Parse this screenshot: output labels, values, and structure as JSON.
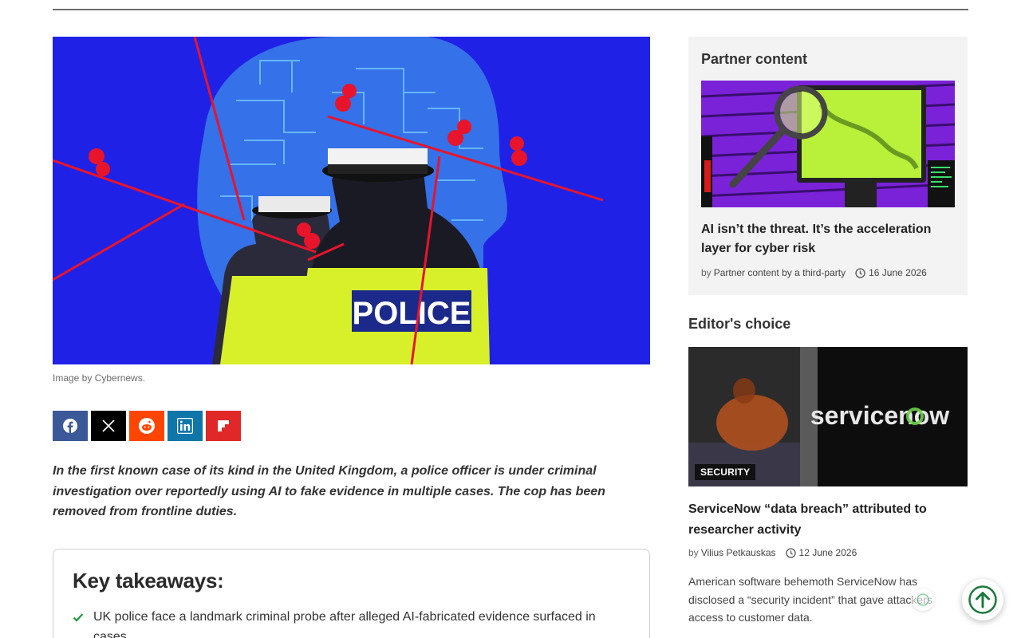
{
  "article": {
    "hero_alt": "Police officers in front of a circuit-board head with red pins and string",
    "caption": "Image by Cybernews.",
    "share": [
      {
        "name": "facebook",
        "color": "#3b5998"
      },
      {
        "name": "x",
        "color": "#000000"
      },
      {
        "name": "reddit",
        "color": "#ff4500"
      },
      {
        "name": "linkedin",
        "color": "#0e76a8"
      },
      {
        "name": "flipboard",
        "color": "#e12828"
      }
    ],
    "lead": "In the first known case of its kind in the United Kingdom, a police officer is under criminal investigation over reportedly using AI to fake evidence in multiple cases. The cop has been removed from frontline duties.",
    "takeaways": {
      "heading": "Key takeaways:",
      "items": [
        "UK police face a landmark criminal probe after alleged AI-fabricated evidence surfaced in cases."
      ]
    },
    "hero_text": "POLICE"
  },
  "sidebar": {
    "partner": {
      "heading": "Partner content",
      "title": "AI isn’t the threat. It’s the acceleration layer for cyber risk",
      "by": "by",
      "author": "Partner content by a third-party",
      "date": "16 June 2026"
    },
    "editor": {
      "heading": "Editor's choice",
      "badge": "SECURITY",
      "logo_text": "servicenow",
      "title": "ServiceNow “data breach” attributed to researcher activity",
      "by": "by",
      "author": "Vilius Petkauskas",
      "date": "12 June 2026",
      "description": "American software behemoth ServiceNow has disclosed a “security incident” that gave attackers access to customer data."
    }
  },
  "colors": {
    "hero_bg": "#1f22e6",
    "pin_red": "#e8142b",
    "hi_vis": "#d8f02a",
    "check_green": "#1a9b3c",
    "scroll_green": "#1a7a3c"
  }
}
